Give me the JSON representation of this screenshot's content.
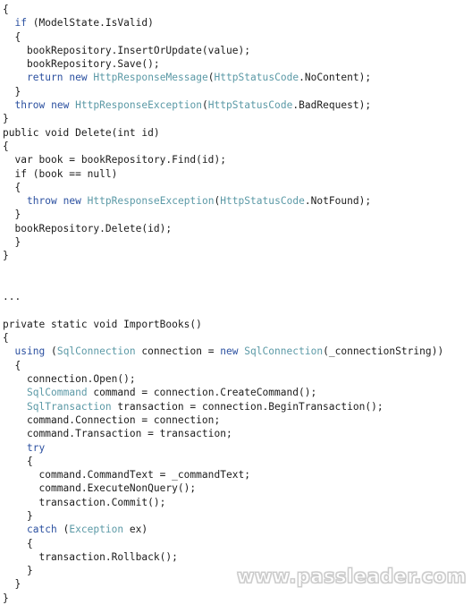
{
  "document": {
    "language": "C#",
    "background_color": "#ffffff",
    "keyword_color": "#2b50a0",
    "type_color": "#5b99a6",
    "text_color": "#1b1b1b",
    "lines": [
      [
        {
          "t": "{",
          "c": "pun"
        }
      ],
      [
        {
          "t": "  ",
          "c": "pun"
        },
        {
          "t": "if",
          "c": "kw"
        },
        {
          "t": " (ModelState.IsValid)",
          "c": "id"
        }
      ],
      [
        {
          "t": "  {",
          "c": "pun"
        }
      ],
      [
        {
          "t": "    bookRepository.InsertOrUpdate(value);",
          "c": "id"
        }
      ],
      [
        {
          "t": "    bookRepository.Save();",
          "c": "id"
        }
      ],
      [
        {
          "t": "    ",
          "c": "pun"
        },
        {
          "t": "return",
          "c": "kw"
        },
        {
          "t": " ",
          "c": "id"
        },
        {
          "t": "new",
          "c": "kw"
        },
        {
          "t": " ",
          "c": "id"
        },
        {
          "t": "HttpResponseMessage",
          "c": "type"
        },
        {
          "t": "(",
          "c": "pun"
        },
        {
          "t": "HttpStatusCode",
          "c": "type"
        },
        {
          "t": ".NoContent);",
          "c": "id"
        }
      ],
      [
        {
          "t": "  }",
          "c": "pun"
        }
      ],
      [
        {
          "t": "  ",
          "c": "pun"
        },
        {
          "t": "throw",
          "c": "kw"
        },
        {
          "t": " ",
          "c": "id"
        },
        {
          "t": "new",
          "c": "kw"
        },
        {
          "t": " ",
          "c": "id"
        },
        {
          "t": "HttpResponseException",
          "c": "type"
        },
        {
          "t": "(",
          "c": "pun"
        },
        {
          "t": "HttpStatusCode",
          "c": "type"
        },
        {
          "t": ".BadRequest);",
          "c": "id"
        }
      ],
      [
        {
          "t": "}",
          "c": "pun"
        }
      ],
      [
        {
          "t": "public void Delete(int id)",
          "c": "id"
        }
      ],
      [
        {
          "t": "{",
          "c": "pun"
        }
      ],
      [
        {
          "t": "  var book = bookRepository.Find(id);",
          "c": "id"
        }
      ],
      [
        {
          "t": "  if (book == null)",
          "c": "id"
        }
      ],
      [
        {
          "t": "  {",
          "c": "pun"
        }
      ],
      [
        {
          "t": "    ",
          "c": "pun"
        },
        {
          "t": "throw",
          "c": "kw"
        },
        {
          "t": " ",
          "c": "id"
        },
        {
          "t": "new",
          "c": "kw"
        },
        {
          "t": " ",
          "c": "id"
        },
        {
          "t": "HttpResponseException",
          "c": "type"
        },
        {
          "t": "(",
          "c": "pun"
        },
        {
          "t": "HttpStatusCode",
          "c": "type"
        },
        {
          "t": ".NotFound);",
          "c": "id"
        }
      ],
      [
        {
          "t": "  }",
          "c": "pun"
        }
      ],
      [
        {
          "t": "  bookRepository.Delete(id);",
          "c": "id"
        }
      ],
      [
        {
          "t": "  }",
          "c": "pun"
        }
      ],
      [
        {
          "t": "}",
          "c": "pun"
        }
      ],
      [
        {
          "t": "",
          "c": "pun"
        }
      ],
      [
        {
          "t": "",
          "c": "pun"
        }
      ],
      [
        {
          "t": "...",
          "c": "id"
        }
      ],
      [
        {
          "t": "",
          "c": "pun"
        }
      ],
      [
        {
          "t": "private static void ImportBooks()",
          "c": "id"
        }
      ],
      [
        {
          "t": "{",
          "c": "pun"
        }
      ],
      [
        {
          "t": "  ",
          "c": "pun"
        },
        {
          "t": "using",
          "c": "kw"
        },
        {
          "t": " (",
          "c": "pun"
        },
        {
          "t": "SqlConnection",
          "c": "type"
        },
        {
          "t": " connection = ",
          "c": "id"
        },
        {
          "t": "new",
          "c": "kw"
        },
        {
          "t": " ",
          "c": "id"
        },
        {
          "t": "SqlConnection",
          "c": "type"
        },
        {
          "t": "(_connectionString))",
          "c": "id"
        }
      ],
      [
        {
          "t": "  {",
          "c": "pun"
        }
      ],
      [
        {
          "t": "    connection.Open();",
          "c": "id"
        }
      ],
      [
        {
          "t": "    ",
          "c": "pun"
        },
        {
          "t": "SqlCommand",
          "c": "type"
        },
        {
          "t": " command = connection.CreateCommand();",
          "c": "id"
        }
      ],
      [
        {
          "t": "    ",
          "c": "pun"
        },
        {
          "t": "SqlTransaction",
          "c": "type"
        },
        {
          "t": " transaction = connection.BeginTransaction();",
          "c": "id"
        }
      ],
      [
        {
          "t": "    command.Connection = connection;",
          "c": "id"
        }
      ],
      [
        {
          "t": "    command.Transaction = transaction;",
          "c": "id"
        }
      ],
      [
        {
          "t": "    ",
          "c": "pun"
        },
        {
          "t": "try",
          "c": "kw"
        }
      ],
      [
        {
          "t": "    {",
          "c": "pun"
        }
      ],
      [
        {
          "t": "      command.CommandText = _commandText;",
          "c": "id"
        }
      ],
      [
        {
          "t": "      command.ExecuteNonQuery();",
          "c": "id"
        }
      ],
      [
        {
          "t": "      transaction.Commit();",
          "c": "id"
        }
      ],
      [
        {
          "t": "    }",
          "c": "pun"
        }
      ],
      [
        {
          "t": "    ",
          "c": "pun"
        },
        {
          "t": "catch",
          "c": "kw"
        },
        {
          "t": " (",
          "c": "pun"
        },
        {
          "t": "Exception",
          "c": "type"
        },
        {
          "t": " ex)",
          "c": "id"
        }
      ],
      [
        {
          "t": "    {",
          "c": "pun"
        }
      ],
      [
        {
          "t": "      transaction.Rollback();",
          "c": "id"
        }
      ],
      [
        {
          "t": "    }",
          "c": "pun"
        }
      ],
      [
        {
          "t": "  }",
          "c": "pun"
        }
      ],
      [
        {
          "t": "}",
          "c": "pun"
        }
      ]
    ]
  },
  "watermark": {
    "text": "www.passleader.com",
    "color": "#d3d3d3"
  }
}
